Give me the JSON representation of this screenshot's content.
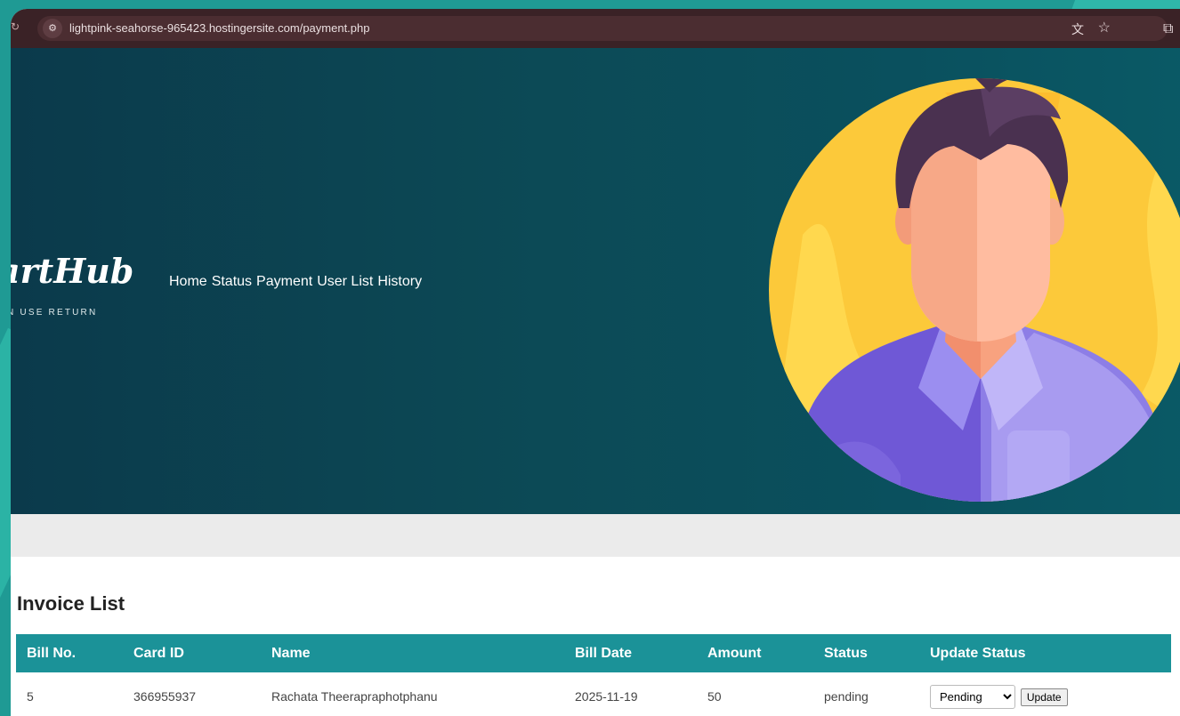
{
  "browser": {
    "url": "lightpink-seahorse-965423.hostingersite.com/payment.php",
    "site_info_icon": "tune-icon",
    "translate_icon": "translate-icon",
    "bookmark_icon": "star-icon"
  },
  "hero": {
    "logo": "artHub",
    "tagline": "N USE RETURN",
    "nav": [
      "Home",
      "Status",
      "Payment",
      "User List",
      "History"
    ]
  },
  "invoice": {
    "title": "Invoice List",
    "columns": [
      "Bill No.",
      "Card ID",
      "Name",
      "Bill Date",
      "Amount",
      "Status",
      "Update Status"
    ],
    "rows": [
      {
        "bill_no": "5",
        "card_id": "366955937",
        "name": "Rachata Theerapraphotphanu",
        "bill_date": "2025-11-19",
        "amount": "50",
        "status": "pending",
        "select_value": "Pending",
        "update_label": "Update"
      }
    ]
  },
  "colors": {
    "hero_bg": "#0c4a56",
    "table_header": "#1b9298",
    "frame_bg": "#1f9a94"
  }
}
